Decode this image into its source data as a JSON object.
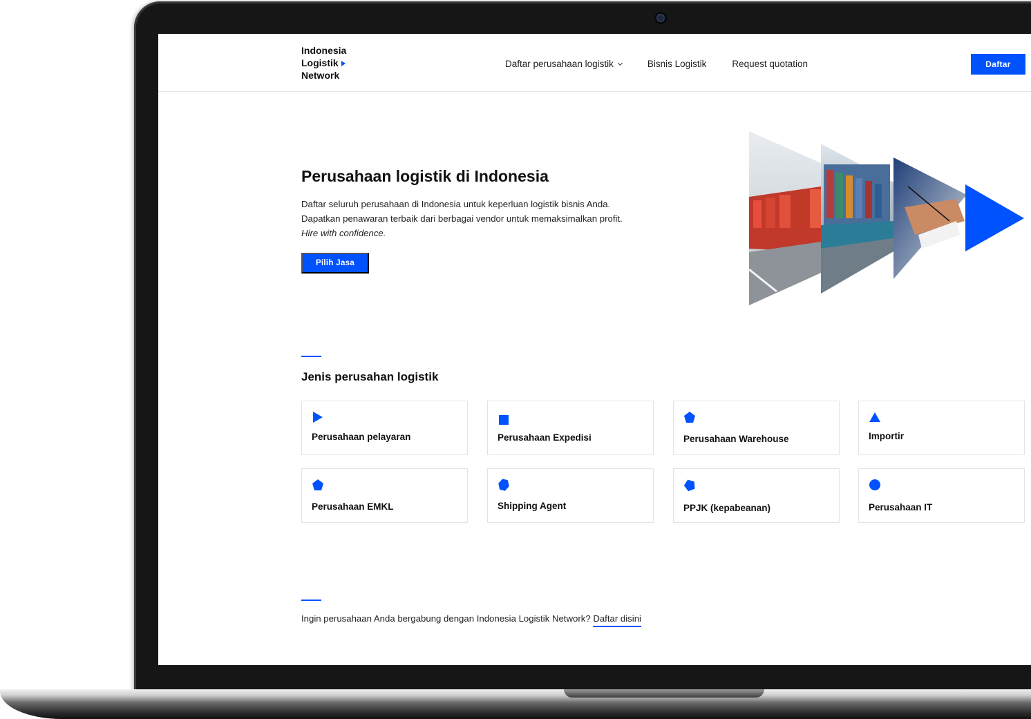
{
  "header": {
    "logo_lines": [
      "Indonesia",
      "Logistik",
      "Network"
    ],
    "nav": [
      {
        "label": "Daftar perusahaan logistik"
      },
      {
        "label": "Bisnis Logistik"
      },
      {
        "label": "Request quotation"
      }
    ],
    "cta_label": "Daftar"
  },
  "hero": {
    "title": "Perusahaan logistik di Indonesia",
    "line1": "Daftar seluruh perusahaan di Indonesia untuk keperluan logistik bisnis Anda.",
    "line2": "Dapatkan penawaran terbaik dari berbagai vendor untuk memaksimalkan profit.",
    "tagline": "Hire with confidence.",
    "button_label": "Pilih Jasa"
  },
  "section": {
    "title": "Jenis perusahan logistik",
    "cards": [
      {
        "label": "Perusahaan pelayaran",
        "icon": "play-triangle-icon"
      },
      {
        "label": "Perusahaan Expedisi",
        "icon": "square-icon"
      },
      {
        "label": "Perusahaan Warehouse",
        "icon": "pentagon-icon"
      },
      {
        "label": "Importir",
        "icon": "triangle-icon"
      },
      {
        "label": "Perusahaan EMKL",
        "icon": "pentagon-icon"
      },
      {
        "label": "Shipping Agent",
        "icon": "hexagon-icon"
      },
      {
        "label": "PPJK (kepabeanan)",
        "icon": "tilted-pentagon-icon"
      },
      {
        "label": "Perusahaan IT",
        "icon": "circle-icon"
      }
    ]
  },
  "footer": {
    "text": "Ingin perusahaan Anda bergabung dengan Indonesia Logistik Network?",
    "link_label": "Daftar disini"
  },
  "colors": {
    "accent": "#0052ff"
  }
}
